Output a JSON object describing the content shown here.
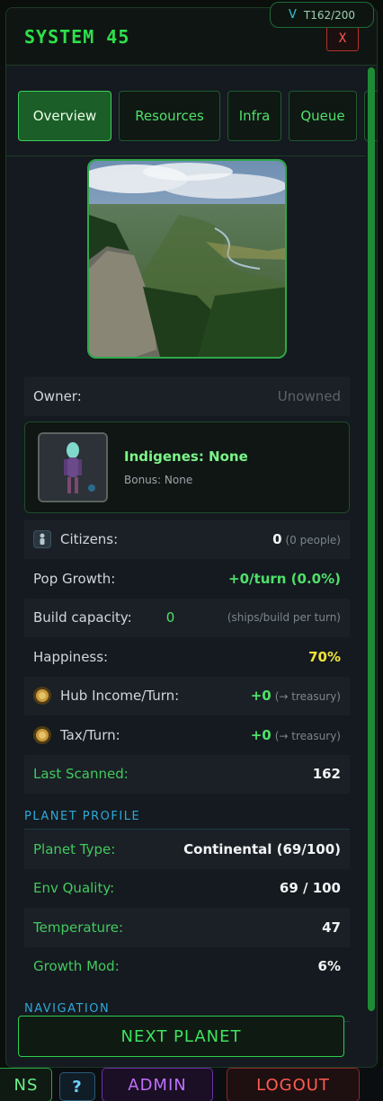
{
  "header": {
    "title": "SYSTEM 45",
    "close_label": "X"
  },
  "turn_badge": {
    "icon": "V",
    "label": "T162/200"
  },
  "tabs": [
    {
      "label": "Overview",
      "active": true
    },
    {
      "label": "Resources",
      "active": false
    },
    {
      "label": "Infra",
      "active": false
    },
    {
      "label": "Queue",
      "active": false
    }
  ],
  "owner": {
    "label": "Owner:",
    "value": "Unowned"
  },
  "indigenes": {
    "title": "Indigenes: None",
    "bonus": "Bonus: None",
    "portrait_icon": "alien-portrait-icon"
  },
  "stats": {
    "citizens": {
      "label": "Citizens:",
      "value": "0",
      "note": "(0 people)",
      "icon": "person-icon"
    },
    "pop_growth": {
      "label": "Pop Growth:",
      "value": "+0/turn (0.0%)"
    },
    "build_capacity": {
      "label": "Build capacity:",
      "value": "0",
      "note": "(ships/build per turn)"
    },
    "happiness": {
      "label": "Happiness:",
      "value": "70%"
    },
    "hub_income": {
      "label": "Hub Income/Turn:",
      "value": "+0",
      "note": "(→ treasury)",
      "icon": "coin-icon"
    },
    "tax": {
      "label": "Tax/Turn:",
      "value": "+0",
      "note": "(→ treasury)",
      "icon": "coin-icon"
    },
    "last_scanned": {
      "label": "Last Scanned:",
      "value": "162"
    }
  },
  "planet_profile": {
    "title": "PLANET PROFILE",
    "type": {
      "label": "Planet Type:",
      "value": "Continental (69/100)"
    },
    "env": {
      "label": "Env Quality:",
      "value": "69 / 100"
    },
    "temp": {
      "label": "Temperature:",
      "value": "47"
    },
    "growth": {
      "label": "Growth Mod:",
      "value": "6%"
    }
  },
  "navigation": {
    "title": "NAVIGATION",
    "next_label": "NEXT PLANET"
  },
  "bottom_bar": {
    "ns": "NS",
    "help": "?",
    "admin": "ADMIN",
    "logout": "LOGOUT"
  },
  "colors": {
    "accent": "#2ee04a",
    "danger": "#ff5a4e",
    "highlight": "#f1e43a",
    "section": "#2fa8d8"
  }
}
